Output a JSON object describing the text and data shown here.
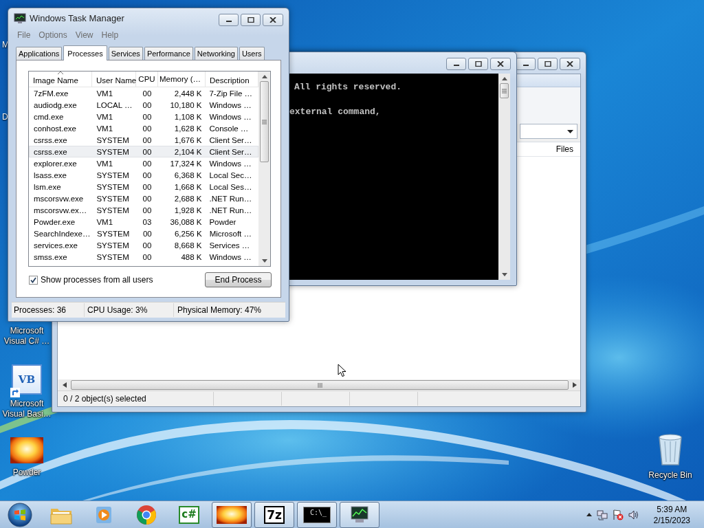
{
  "desktop": {
    "hidden_labels": [
      "M",
      "D"
    ],
    "icons": [
      {
        "kind": "csharp",
        "lines": [
          "Microsoft",
          "Visual C# …"
        ]
      },
      {
        "kind": "vb",
        "badge": "VB",
        "lines": [
          "Microsoft",
          "Visual Basi…"
        ]
      },
      {
        "kind": "powder",
        "lines": [
          "Powder"
        ]
      },
      {
        "kind": "recycle",
        "lines": [
          "Recycle Bin"
        ]
      }
    ]
  },
  "explorer": {
    "column_header": "Files",
    "status": "0 / 2 object(s) selected"
  },
  "console": {
    "lines": [
      "All rights reserved.",
      "external command,"
    ]
  },
  "task_manager": {
    "title": "Windows Task Manager",
    "menu": [
      "File",
      "Options",
      "View",
      "Help"
    ],
    "tabs": [
      {
        "label": "Applications",
        "selected": false
      },
      {
        "label": "Processes",
        "selected": true
      },
      {
        "label": "Services",
        "selected": false
      },
      {
        "label": "Performance",
        "selected": false
      },
      {
        "label": "Networking",
        "selected": false
      },
      {
        "label": "Users",
        "selected": false
      }
    ],
    "columns": [
      {
        "label": "Image Name",
        "sorted": true
      },
      {
        "label": "User Name",
        "sorted": false
      },
      {
        "label": "CPU",
        "sorted": false
      },
      {
        "label": "Memory (…",
        "sorted": false
      },
      {
        "label": "Description",
        "sorted": false
      }
    ],
    "rows": [
      {
        "cells": [
          "7zFM.exe",
          "VM1",
          "00",
          "2,448 K",
          "7-Zip File …"
        ],
        "selected": false
      },
      {
        "cells": [
          "audiodg.exe",
          "LOCAL …",
          "00",
          "10,180 K",
          "Windows …"
        ],
        "selected": false
      },
      {
        "cells": [
          "cmd.exe",
          "VM1",
          "00",
          "1,108 K",
          "Windows …"
        ],
        "selected": false
      },
      {
        "cells": [
          "conhost.exe",
          "VM1",
          "00",
          "1,628 K",
          "Console …"
        ],
        "selected": false
      },
      {
        "cells": [
          "csrss.exe",
          "SYSTEM",
          "00",
          "1,676 K",
          "Client Ser…"
        ],
        "selected": false
      },
      {
        "cells": [
          "csrss.exe",
          "SYSTEM",
          "00",
          "2,104 K",
          "Client Ser…"
        ],
        "selected": true
      },
      {
        "cells": [
          "explorer.exe",
          "VM1",
          "00",
          "17,324 K",
          "Windows …"
        ],
        "selected": false
      },
      {
        "cells": [
          "lsass.exe",
          "SYSTEM",
          "00",
          "6,368 K",
          "Local Sec…"
        ],
        "selected": false
      },
      {
        "cells": [
          "lsm.exe",
          "SYSTEM",
          "00",
          "1,668 K",
          "Local Ses…"
        ],
        "selected": false
      },
      {
        "cells": [
          "mscorsvw.exe",
          "SYSTEM",
          "00",
          "2,688 K",
          ".NET Run…"
        ],
        "selected": false
      },
      {
        "cells": [
          "mscorsvw.ex…",
          "SYSTEM",
          "00",
          "1,928 K",
          ".NET Run…"
        ],
        "selected": false
      },
      {
        "cells": [
          "Powder.exe",
          "VM1",
          "03",
          "36,088 K",
          "Powder"
        ],
        "selected": false
      },
      {
        "cells": [
          "SearchIndexe…",
          "SYSTEM",
          "00",
          "6,256 K",
          "Microsoft …"
        ],
        "selected": false
      },
      {
        "cells": [
          "services.exe",
          "SYSTEM",
          "00",
          "8,668 K",
          "Services …"
        ],
        "selected": false
      },
      {
        "cells": [
          "smss.exe",
          "SYSTEM",
          "00",
          "488 K",
          "Windows …"
        ],
        "selected": false
      }
    ],
    "show_all_users": {
      "label": "Show processes from all users",
      "checked": true
    },
    "end_process": "End Process",
    "status": [
      "Processes: 36",
      "CPU Usage: 3%",
      "Physical Memory: 47%"
    ]
  },
  "taskbar": {
    "items": [
      {
        "kind": "folder",
        "running": false
      },
      {
        "kind": "media",
        "running": false
      },
      {
        "kind": "browser",
        "running": false
      },
      {
        "kind": "csharp",
        "text": "c#",
        "running": false
      },
      {
        "kind": "powder",
        "running": true
      },
      {
        "kind": "zip",
        "text": "7z",
        "running": true
      },
      {
        "kind": "cmd",
        "text": "C:\\_",
        "running": true
      },
      {
        "kind": "taskmgr",
        "running": true
      }
    ],
    "clock": {
      "time": "5:39 AM",
      "date": "2/15/2023"
    }
  }
}
